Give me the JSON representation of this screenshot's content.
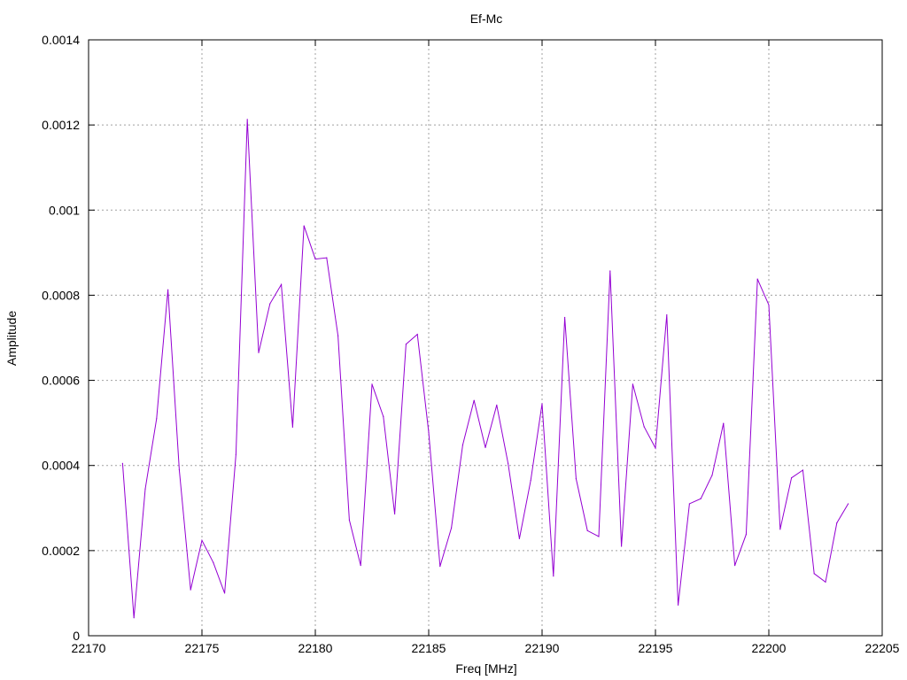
{
  "chart_data": {
    "type": "line",
    "title": "Ef-Mc",
    "xlabel": "Freq [MHz]",
    "ylabel": "Amplitude",
    "xlim": [
      22170,
      22205
    ],
    "ylim": [
      0,
      0.0014
    ],
    "grid": true,
    "x_ticks": [
      22170,
      22175,
      22180,
      22185,
      22190,
      22195,
      22200,
      22205
    ],
    "y_ticks": [
      0,
      0.0002,
      0.0004,
      0.0006,
      0.0008,
      0.001,
      0.0012,
      0.0014
    ],
    "x_tick_labels": [
      "22170",
      "22175",
      "22180",
      "22185",
      "22190",
      "22195",
      "22200",
      "22205"
    ],
    "y_tick_labels": [
      "0",
      "0.0002",
      "0.0004",
      "0.0006",
      "0.0008",
      "0.001",
      "0.0012",
      "0.0014"
    ],
    "series": [
      {
        "color": "#9400d3",
        "x": [
          22171.5,
          22172.0,
          22172.5,
          22173.0,
          22173.5,
          22174.0,
          22174.5,
          22175.0,
          22175.5,
          22176.0,
          22176.5,
          22177.0,
          22177.5,
          22178.0,
          22178.5,
          22179.0,
          22179.5,
          22180.0,
          22180.5,
          22181.0,
          22181.5,
          22182.0,
          22182.5,
          22183.0,
          22183.5,
          22184.0,
          22184.5,
          22185.0,
          22185.5,
          22186.0,
          22186.5,
          22187.0,
          22187.5,
          22188.0,
          22188.5,
          22189.0,
          22189.5,
          22190.0,
          22190.5,
          22191.0,
          22191.5,
          22192.0,
          22192.5,
          22193.0,
          22193.5,
          22194.0,
          22194.5,
          22195.0,
          22195.5,
          22196.0,
          22196.5,
          22197.0,
          22197.5,
          22198.0,
          22198.5,
          22199.0,
          22199.5,
          22200.0,
          22200.5,
          22201.0,
          22201.5,
          22202.0,
          22202.5,
          22203.0,
          22203.5
        ],
        "values": [
          0.000405,
          4.2e-05,
          0.000345,
          0.00051,
          0.000813,
          0.00039,
          0.000108,
          0.000224,
          0.000172,
          0.0001,
          0.000426,
          0.001213,
          0.000665,
          0.00078,
          0.000825,
          0.00049,
          0.000963,
          0.000885,
          0.000888,
          0.000705,
          0.000272,
          0.000165,
          0.000591,
          0.000515,
          0.000286,
          0.000685,
          0.000708,
          0.000478,
          0.000163,
          0.000253,
          0.000448,
          0.000553,
          0.000442,
          0.000542,
          0.000405,
          0.000228,
          0.000365,
          0.000545,
          0.00014,
          0.000748,
          0.000369,
          0.000247,
          0.000233,
          0.000857,
          0.00021,
          0.000591,
          0.000491,
          0.000441,
          0.000754,
          7.2e-05,
          0.00031,
          0.000322,
          0.000377,
          0.000499,
          0.000165,
          0.000238,
          0.000838,
          0.000777,
          0.00025,
          0.000371,
          0.000389,
          0.000146,
          0.000126,
          0.000265,
          0.00031
        ]
      }
    ]
  }
}
